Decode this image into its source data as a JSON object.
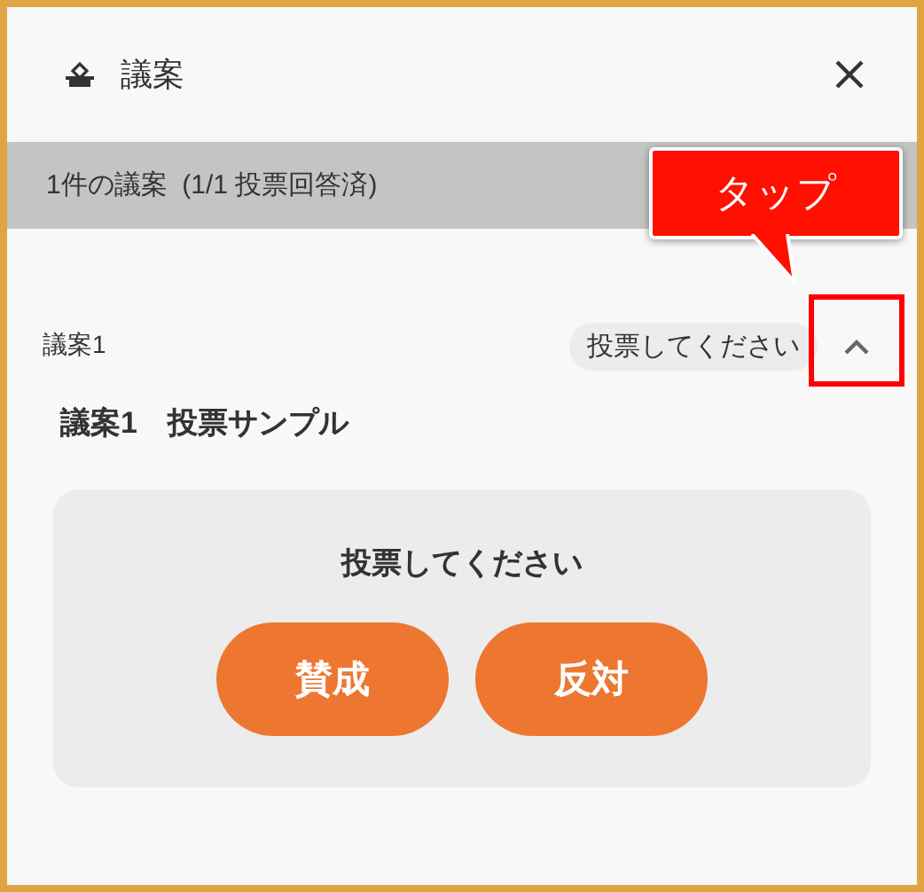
{
  "dialog": {
    "title": "議案"
  },
  "summary": "1件の議案  (1/1 投票回答済)",
  "callout": {
    "text": "タップ"
  },
  "item": {
    "label": "議案1",
    "status": "投票してください",
    "expanded": true,
    "title": "議案1　投票サンプル",
    "prompt": "投票してください",
    "buttons": [
      {
        "label": "賛成"
      },
      {
        "label": "反対"
      }
    ]
  }
}
